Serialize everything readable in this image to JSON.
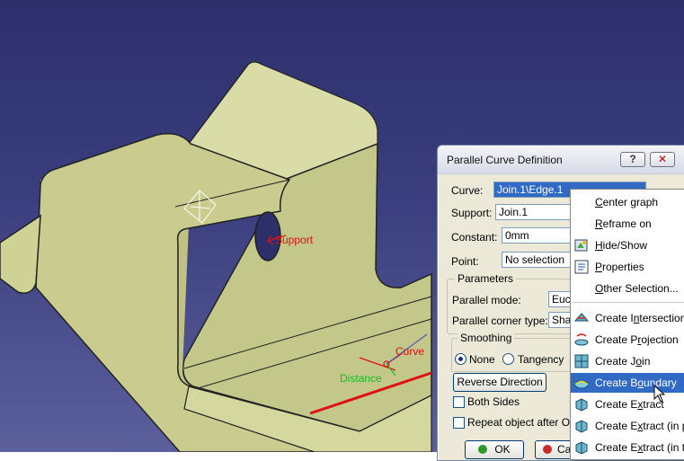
{
  "annotations": {
    "support": "Support",
    "curve": "Curve",
    "distance": "Distance"
  },
  "dialog": {
    "title": "Parallel Curve Definition",
    "help_label": "?",
    "close_label": "✕",
    "curve_label": "Curve:",
    "curve_value": "Join.1\\Edge.1",
    "support_label": "Support:",
    "support_value": "Join.1",
    "constant_label": "Constant:",
    "constant_value": "0mm",
    "point_label": "Point:",
    "point_value": "No selection",
    "parameters_title": "Parameters",
    "parallel_mode_label": "Parallel mode:",
    "parallel_mode_value": "Euc",
    "corner_type_label": "Parallel corner type:",
    "corner_type_value": "Sha",
    "smoothing_title": "Smoothing",
    "smoothing_none": "None",
    "smoothing_tangency": "Tangency",
    "smoothing_selected": "None",
    "reverse_button": "Reverse Direction",
    "both_sides_label": "Both Sides",
    "both_sides_checked": false,
    "repeat_label": "Repeat object after OK",
    "repeat_checked": false,
    "ok_label": "OK",
    "cancel_label": "Ca"
  },
  "context_menu": {
    "items": [
      {
        "label": "Center graph",
        "icon": "none",
        "highlighted": false
      },
      {
        "label": "Reframe on",
        "icon": "none",
        "highlighted": false
      },
      {
        "label": "Hide/Show",
        "icon": "hide-show-icon",
        "highlighted": false
      },
      {
        "label": "Properties",
        "icon": "properties-icon",
        "highlighted": false
      },
      {
        "label": "Other Selection...",
        "icon": "none",
        "highlighted": false
      },
      {
        "label": "Create Intersection",
        "icon": "intersection-icon",
        "highlighted": false
      },
      {
        "label": "Create Projection",
        "icon": "projection-icon",
        "highlighted": false
      },
      {
        "label": "Create Join",
        "icon": "join-icon",
        "highlighted": false
      },
      {
        "label": "Create Boundary",
        "icon": "boundary-icon",
        "highlighted": true
      },
      {
        "label": "Create Extract",
        "icon": "extract-icon",
        "highlighted": false
      },
      {
        "label": "Create Extract (in p",
        "icon": "extract-icon",
        "highlighted": false
      },
      {
        "label": "Create Extract (in ta",
        "icon": "extract-icon",
        "highlighted": false
      }
    ]
  },
  "colors": {
    "background_top": "#2c2f6a",
    "part_fill": "#c9cc8e",
    "highlight": "#316ac5",
    "annotation_red": "#e01010",
    "annotation_green": "#10c020"
  }
}
